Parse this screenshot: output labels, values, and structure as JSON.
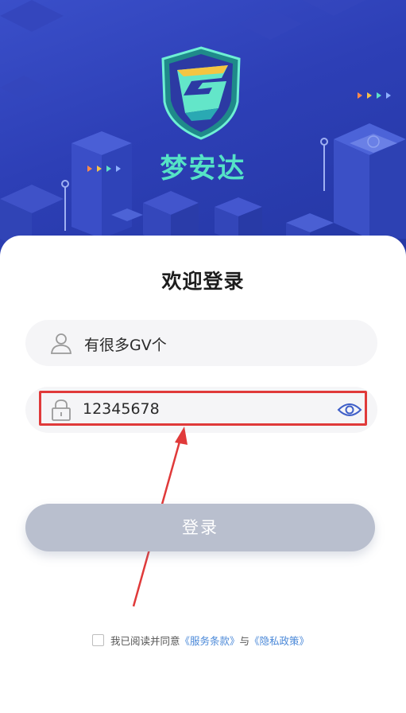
{
  "brand": {
    "name": "梦安达"
  },
  "login": {
    "title": "欢迎登录",
    "username_value": "有很多GV个",
    "password_value": "12345678",
    "submit_label": "登录"
  },
  "agreement": {
    "prefix": "我已阅读并同意",
    "terms_link": "《服务条款》",
    "joiner": "与",
    "privacy_link": "《隐私政策》"
  },
  "colors": {
    "hero_bg": "#2d3fb6",
    "brand_text": "#55e3c6",
    "button_disabled": "#b9bfce",
    "link": "#4a88d8",
    "annotation": "#e03a3a"
  },
  "icons": [
    "user-icon",
    "lock-icon",
    "eye-icon",
    "checkbox-icon"
  ]
}
